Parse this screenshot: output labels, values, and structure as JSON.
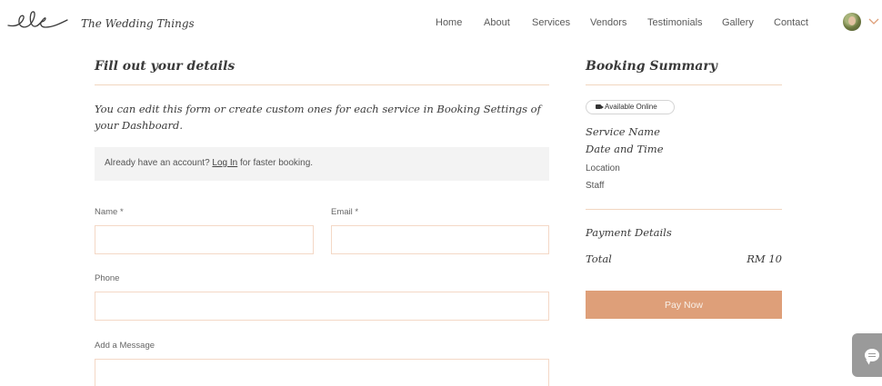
{
  "header": {
    "brand_name": "The Wedding Things",
    "logo_icon": "script-ele-logo",
    "nav": [
      {
        "label": "Home"
      },
      {
        "label": "About"
      },
      {
        "label": "Services"
      },
      {
        "label": "Vendors"
      },
      {
        "label": "Testimonials"
      },
      {
        "label": "Gallery"
      },
      {
        "label": "Contact"
      }
    ],
    "account_icon": "avatar",
    "menu_icon": "chevron-down-icon"
  },
  "form": {
    "heading": "Fill out your details",
    "description": "You can edit this form or create custom ones for each service in Booking Settings of your Dashboard.",
    "login_prompt": {
      "before": "Already have an account? ",
      "link": "Log In",
      "after": " for faster booking."
    },
    "fields": {
      "name_label": "Name *",
      "name_value": "",
      "email_label": "Email *",
      "email_value": "",
      "phone_label": "Phone",
      "phone_value": "",
      "message_label": "Add a Message",
      "message_value": ""
    }
  },
  "summary": {
    "heading": "Booking Summary",
    "badge": "Available Online",
    "badge_icon": "video-camera-icon",
    "service_name": "Service Name",
    "date_time": "Date and Time",
    "location": "Location",
    "staff": "Staff",
    "payment_heading": "Payment Details",
    "total_label": "Total",
    "total_value": "RM 10",
    "pay_button": "Pay Now"
  },
  "chat_widget_icon": "chat-bubble-icon",
  "colors": {
    "accent": "#de9f79",
    "divider": "#f1d6c0",
    "input_border": "#f4d8c6",
    "login_bg": "#f3f3f3",
    "chat_bg": "#9a9a9a"
  }
}
